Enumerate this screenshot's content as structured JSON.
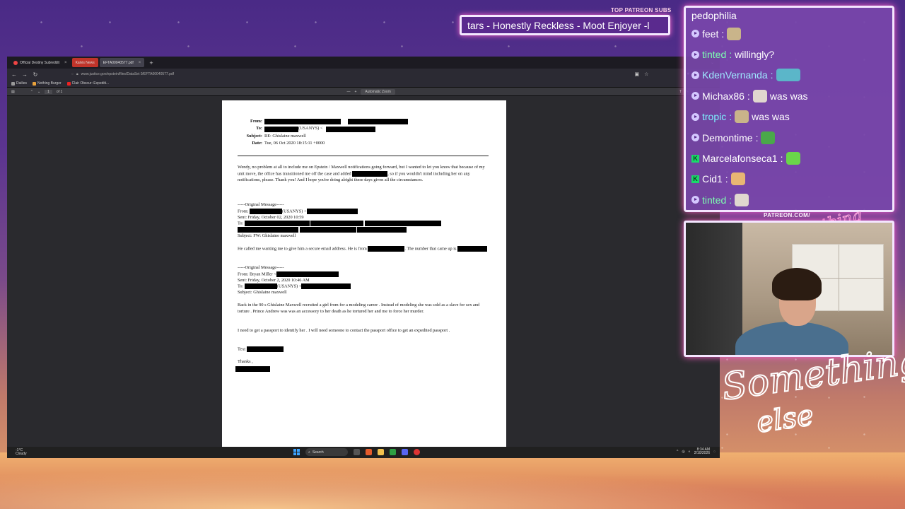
{
  "overlay": {
    "patreon_header": "TOP PATREON SUBS",
    "ticker_text": "tars - Honestly Reckless - Moot Enjoyer -l",
    "patreon_url": "PATREON.COM/",
    "logo_small": "Anything else?",
    "logo_big_1": "Something",
    "logo_big_2": "else"
  },
  "chat": [
    {
      "user": "pedophilia",
      "message": "",
      "badge": "none",
      "emote": "",
      "color": "#ffffff"
    },
    {
      "user": "feet",
      "message": "",
      "badge": "prime",
      "emote": "peepo",
      "color": "#ffffff"
    },
    {
      "user": "tinted",
      "message": "willingly?",
      "badge": "prime",
      "emote": "",
      "color": "#7dffb0"
    },
    {
      "user": "KdenVernanda",
      "message": "",
      "badge": "prime",
      "emote": "hands",
      "color": "#9ee8ff"
    },
    {
      "user": "Michax86",
      "message": "was was",
      "badge": "prime",
      "emote": "weird-face",
      "color": "#ffffff"
    },
    {
      "user": "tropic",
      "message": "was was",
      "badge": "prime",
      "emote": "peepo",
      "color": "#7df2ff"
    },
    {
      "user": "Demontime",
      "message": "",
      "badge": "prime",
      "emote": "pepe",
      "color": "#ffffff"
    },
    {
      "user": "Marcelafonseca1",
      "message": "",
      "badge": "kick",
      "emote": "green-blob",
      "color": "#ffffff"
    },
    {
      "user": "Cid1",
      "message": "",
      "badge": "kick",
      "emote": "pizza-face",
      "color": "#ffffff"
    },
    {
      "user": "tinted",
      "message": "",
      "badge": "prime",
      "emote": "weird-face",
      "color": "#7dffb0"
    }
  ],
  "browser": {
    "tabs": [
      {
        "label": "Official Destiny Subreddit",
        "active": false
      },
      {
        "label": "Kalvis News",
        "active": false
      },
      {
        "label": "EFTA00040577.pdf",
        "active": true
      }
    ],
    "url": "www.justice.gov/epstein/files/DataSet 9/EFTA00040577.pdf",
    "bookmarks": [
      "Dailies",
      "Nothing Burger",
      "Clair Obscur: Expediti..."
    ],
    "page_number": "1",
    "page_count": "of 1",
    "zoom": "Automatic Zoom"
  },
  "document": {
    "from_label": "From:",
    "to_label": "To:",
    "to_suffix": "(USANYS) <",
    "subject_label": "Subject:",
    "subject": "RE: Ghislaine maxwell",
    "date_label": "Date:",
    "date": "Tue, 06 Oct 2020 18:15:11 +0000",
    "para1": "Wendy, no problem at all to include me on Epstein / Maxwell notifications going forward, but I wanted to let you know that because of my unit move, the office has transitioned me off the case and added",
    "para1b": ", so if you wouldn't mind including her on any notifications, please. Thank you! And I hope you're doing alright these days given all the circumstances.",
    "orig1_header": "-----Original Message-----",
    "orig1_from": "From:",
    "orig1_from_suffix": "(USANYS) <",
    "orig1_sent": "Sent: Friday, October 02, 2020 10:59",
    "orig1_to": "To:",
    "orig1_subject": "Subject: FW: Ghislaine maxwell",
    "para2": "He called me wanting me to give him a secure email address. He is from",
    "para2b": ". The number that came up is",
    "orig2_header": "-----Original Message-----",
    "orig2_from": "From: Bryan Miller <",
    "orig2_sent": "Sent: Friday, October 2, 2020 10:46 AM",
    "orig2_to": "To:",
    "orig2_to_suffix": "(USANYS) <",
    "orig2_subject": "Subject: Ghislaine maxwell",
    "para3": "Back in the 90 s Ghislaine Maxwell recruited a girl from for a modeling career . Instead of modeling she was sold as a slave for sex and torture . Prince Andrew was was an accessory to her death as he tortured her and me to force her murder.",
    "para4": "I need to get a passport to identify her . I will need someone to contact the passport office to get an expedited passport .",
    "text_label": "Text",
    "thanks": "Thanks ,"
  },
  "taskbar": {
    "weather_temp": "-1°C",
    "weather_desc": "Cloudy",
    "search": "Search",
    "time": "8:34 AM",
    "date": "2/10/2026"
  }
}
